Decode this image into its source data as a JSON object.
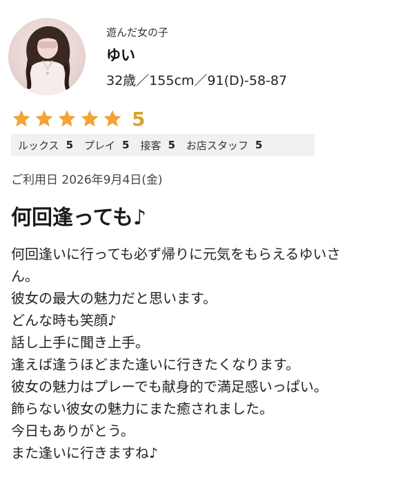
{
  "profile": {
    "sub_label": "遊んだ女の子",
    "name": "ゆい",
    "stats": "32歳／155cm／91(D)-58-87"
  },
  "rating": {
    "stars": 5,
    "max_stars": 5,
    "score_text": "5",
    "star_color": "#f0a43a",
    "categories": [
      {
        "label": "ルックス",
        "value": "5"
      },
      {
        "label": "プレイ",
        "value": "5"
      },
      {
        "label": "接客",
        "value": "5"
      },
      {
        "label": "お店スタッフ",
        "value": "5"
      }
    ]
  },
  "visit_date": "ご利用日 2026年9月4日(金)",
  "review": {
    "title": "何回逢っても♪",
    "lines": [
      "何回逢いに行っても必ず帰りに元気をもらえるゆいさ",
      "ん。",
      "彼女の最大の魅力だと思います。",
      "どんな時も笑顔♪",
      "話し上手に聞き上手。",
      "逢えば逢うほどまた逢いに行きたくなります。",
      "彼女の魅力はプレーでも献身的で満足感いっぱい。",
      "飾らない彼女の魅力にまた癒されました。",
      "今日もありがとう。",
      "また逢いに行きますね♪"
    ]
  }
}
